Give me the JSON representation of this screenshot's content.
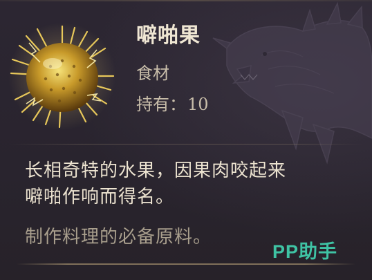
{
  "item": {
    "name": "噼啪果",
    "category": "食材",
    "count_label": "持有：",
    "count_value": "10"
  },
  "description": {
    "line1": "长相奇特的水果，因果肉咬起来",
    "line2": "噼啪作响而得名。",
    "note": "制作料理的必备原料。"
  },
  "watermark": "PP助手",
  "icons": {
    "item": "spiky-golden-fruit-icon",
    "background": "dragon-silhouette-icon"
  },
  "colors": {
    "background": "#2a2530",
    "name_text": "#efe6d3",
    "secondary_text": "#c9beaa",
    "note_text": "#a99f8d",
    "watermark": "#3fc3a4"
  }
}
